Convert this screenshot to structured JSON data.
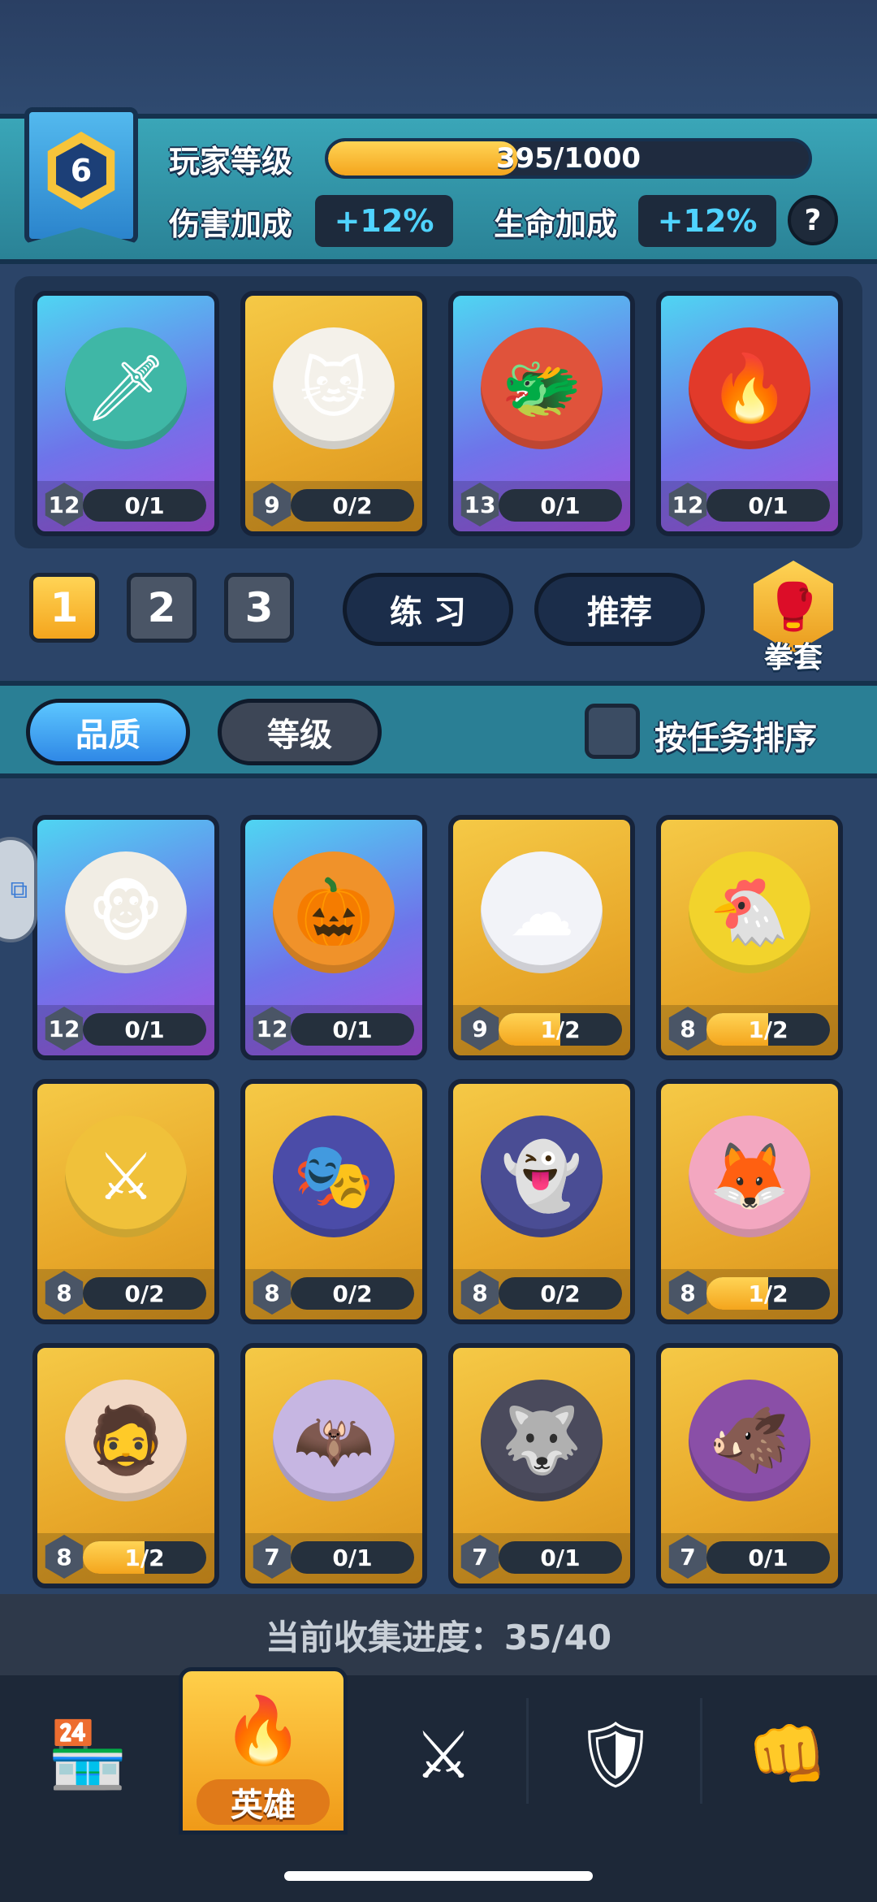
{
  "player": {
    "level": "6",
    "level_label": "玩家等级",
    "xp_text": "395/1000",
    "xp_fraction": 0.395,
    "damage_label": "伤害加成",
    "damage_value": "+12%",
    "hp_label": "生命加成",
    "hp_value": "+12%",
    "help_icon": "question-icon",
    "help_text": "?"
  },
  "team": [
    {
      "rarity": "purple",
      "level": "12",
      "count": "0/1",
      "fraction": 0,
      "icon": "teal-knight-hero",
      "glyph": "🗡",
      "color": "#3fb7a6"
    },
    {
      "rarity": "gold",
      "level": "9",
      "count": "0/2",
      "fraction": 0,
      "icon": "white-cat-hero",
      "glyph": "🐱",
      "color": "#f4f1ea"
    },
    {
      "rarity": "purple",
      "level": "13",
      "count": "0/1",
      "fraction": 0,
      "icon": "red-dragon-hero",
      "glyph": "🐲",
      "color": "#e0533b"
    },
    {
      "rarity": "purple",
      "level": "12",
      "count": "0/1",
      "fraction": 0,
      "icon": "fire-bird-hero",
      "glyph": "🔥",
      "color": "#e23a2a"
    }
  ],
  "decks": {
    "tabs": [
      "1",
      "2",
      "3"
    ],
    "active": 0,
    "practice_label": "练 习",
    "recommend_label": "推荐",
    "glove_label": "拳套",
    "glove_icon": "boxing-glove-icon"
  },
  "sort": {
    "quality_label": "品质",
    "level_label": "等级",
    "task_sort_label": "按任务排序"
  },
  "collection": [
    {
      "rarity": "purple",
      "level": "12",
      "count": "0/1",
      "fraction": 0,
      "icon": "monkey-king-hero",
      "glyph": "🐵",
      "color": "#f1ede4"
    },
    {
      "rarity": "purple",
      "level": "12",
      "count": "0/1",
      "fraction": 0,
      "icon": "pumpkin-hero",
      "glyph": "🎃",
      "color": "#f0922a"
    },
    {
      "rarity": "gold",
      "level": "9",
      "count": "1/2",
      "fraction": 0.5,
      "icon": "cloud-hero",
      "glyph": "☁",
      "color": "#f2f3f8"
    },
    {
      "rarity": "gold",
      "level": "8",
      "count": "1/2",
      "fraction": 0.5,
      "icon": "rooster-hero",
      "glyph": "🐔",
      "color": "#f2d32c"
    },
    {
      "rarity": "gold",
      "level": "8",
      "count": "0/2",
      "fraction": 0,
      "icon": "knight-hero",
      "glyph": "⚔",
      "color": "#f0c13a"
    },
    {
      "rarity": "gold",
      "level": "8",
      "count": "0/2",
      "fraction": 0,
      "icon": "feather-mask-hero",
      "glyph": "🎭",
      "color": "#4b4ca8"
    },
    {
      "rarity": "gold",
      "level": "8",
      "count": "0/2",
      "fraction": 0,
      "icon": "ice-shadow-hero",
      "glyph": "👻",
      "color": "#4a4d94"
    },
    {
      "rarity": "gold",
      "level": "8",
      "count": "1/2",
      "fraction": 0.5,
      "icon": "fox-mask-girl-hero",
      "glyph": "🦊",
      "color": "#f3a7c0"
    },
    {
      "rarity": "gold",
      "level": "8",
      "count": "1/2",
      "fraction": 0.5,
      "icon": "old-dwarf-hero",
      "glyph": "🧔",
      "color": "#f1d7c4"
    },
    {
      "rarity": "gold",
      "level": "7",
      "count": "0/1",
      "fraction": 0,
      "icon": "vampire-maid-hero",
      "glyph": "🦇",
      "color": "#c6b6e2"
    },
    {
      "rarity": "gold",
      "level": "7",
      "count": "0/1",
      "fraction": 0,
      "icon": "wolf-hero",
      "glyph": "🐺",
      "color": "#4a4a5c"
    },
    {
      "rarity": "gold",
      "level": "7",
      "count": "0/1",
      "fraction": 0,
      "icon": "bat-pig-hero",
      "glyph": "🐗",
      "color": "#8a4fa7"
    }
  ],
  "collection_progress": "当前收集进度：35/40",
  "nav": {
    "items": [
      {
        "icon": "shop-icon",
        "glyph": "🏪"
      },
      {
        "icon": "hero-cards-icon",
        "glyph": "🔥",
        "label": "英雄"
      },
      {
        "icon": "crossed-swords-icon",
        "glyph": "⚔"
      },
      {
        "icon": "guild-shield-icon",
        "glyph": "🛡"
      },
      {
        "icon": "fist-bump-icon",
        "glyph": "👊"
      }
    ],
    "active": 1
  }
}
